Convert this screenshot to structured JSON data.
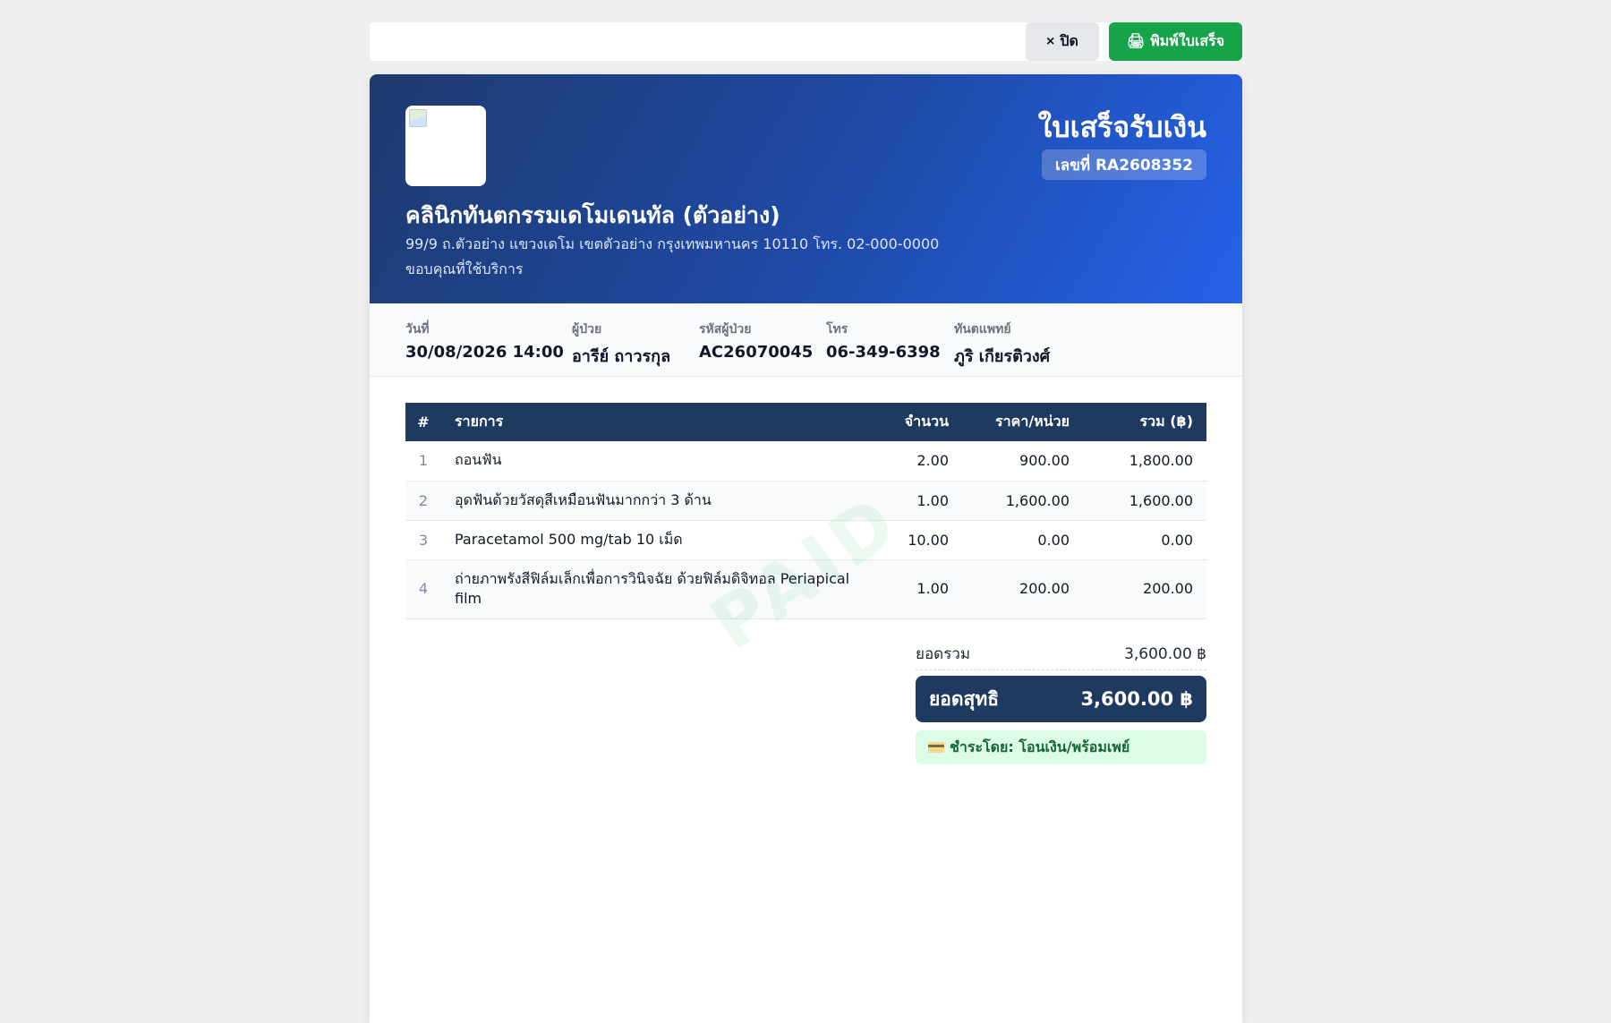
{
  "toolbar": {
    "close_label": "ปิด",
    "close_icon": "×",
    "print_label": "พิมพ์ใบเสร็จ",
    "print_icon": "🖨"
  },
  "header": {
    "doc_title": "ใบเสร็จรับเงิน",
    "doc_no": "เลขที่ RA2608352",
    "clinic_name": "คลินิกทันตกรรมเดโมเดนทัล (ตัวอย่าง)",
    "clinic_address": "99/9 ถ.ตัวอย่าง แขวงเดโม เขตตัวอย่าง กรุงเทพมหานคร 10110 โทร. 02-000-0000",
    "thanks": "ขอบคุณที่ใช้บริการ"
  },
  "meta": {
    "date_label": "วันที่",
    "date_value": "30/08/2026 14:00",
    "patient_label": "ผู้ป่วย",
    "patient_value": "อารีย์ ถาวรกุล",
    "patient_id_label": "รหัสผู้ป่วย",
    "patient_id_value": "AC26070045",
    "phone_label": "โทร",
    "phone_value": "06-349-6398",
    "dentist_label": "ทันตแพทย์",
    "dentist_value": "ภูริ เกียรติวงศ์"
  },
  "table": {
    "headers": {
      "idx": "#",
      "item": "รายการ",
      "qty": "จำนวน",
      "price": "ราคา/หน่วย",
      "total": "รวม (฿)"
    },
    "rows": [
      {
        "idx": "1",
        "item": "ถอนฟัน",
        "qty": "2.00",
        "price": "900.00",
        "total": "1,800.00"
      },
      {
        "idx": "2",
        "item": "อุดฟันด้วยวัสดุสีเหมือนฟันมากกว่า 3 ด้าน",
        "qty": "1.00",
        "price": "1,600.00",
        "total": "1,600.00"
      },
      {
        "idx": "3",
        "item": "Paracetamol 500 mg/tab 10 เม็ด",
        "qty": "10.00",
        "price": "0.00",
        "total": "0.00"
      },
      {
        "idx": "4",
        "item": "ถ่ายภาพรังสีฟิล์มเล็กเพื่อการวินิจฉัย ด้วยฟิล์มดิจิทอล Periapical film",
        "qty": "1.00",
        "price": "200.00",
        "total": "200.00"
      }
    ]
  },
  "watermark": "PAID",
  "summary": {
    "subtotal_label": "ยอดรวม",
    "subtotal_value": "3,600.00 ฿",
    "net_label": "ยอดสุทธิ",
    "net_value": "3,600.00 ฿",
    "paid_by": "ชำระโดย: โอนเงิน/พร้อมเพย์"
  },
  "colors": {
    "header_gradient_start": "#1e3a6e",
    "header_gradient_end": "#2563eb",
    "table_header": "#1e3a5f",
    "print_button": "#16a34a",
    "paid_badge_bg": "#dcfce7"
  }
}
